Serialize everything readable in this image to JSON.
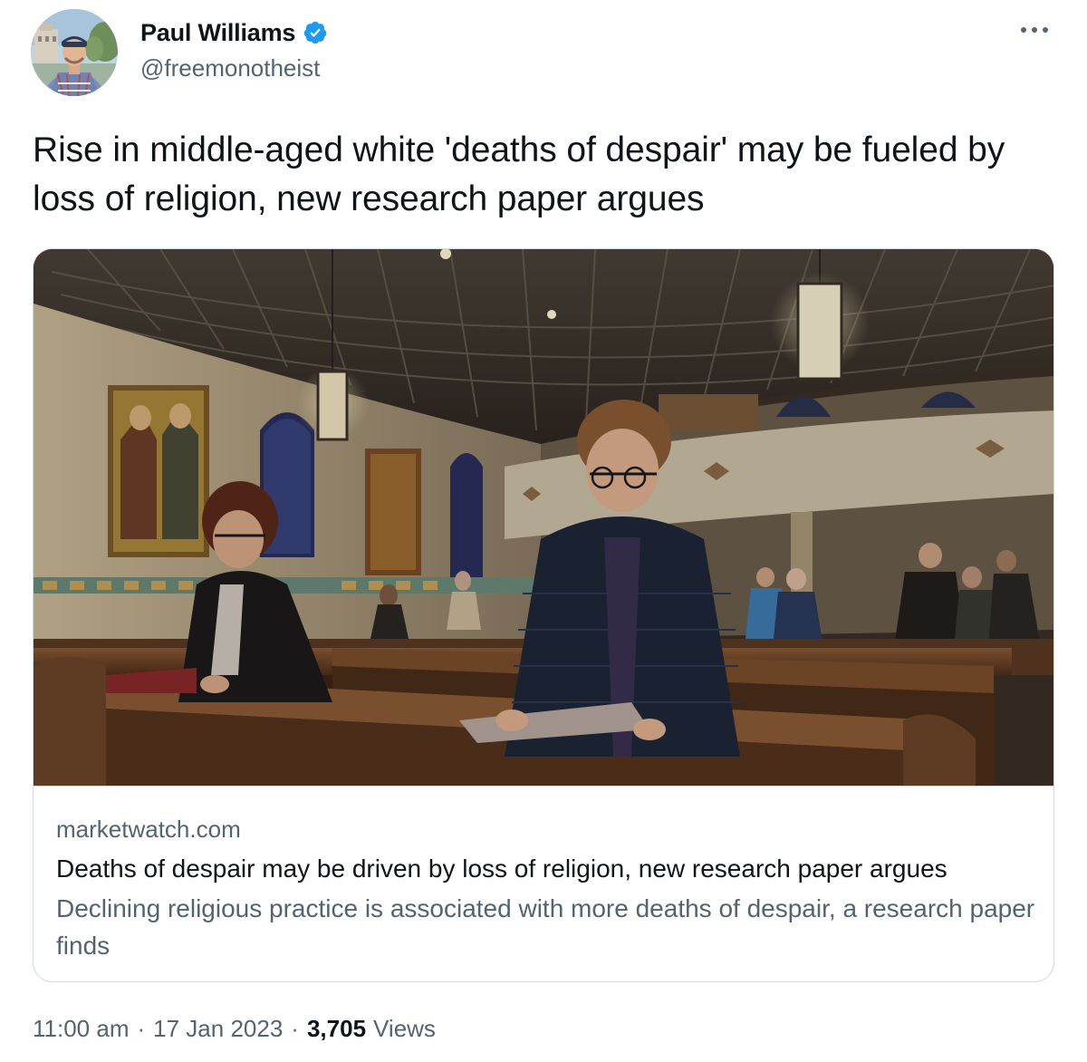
{
  "author": {
    "display_name": "Paul Williams",
    "handle": "@freemonotheist",
    "verified": true,
    "avatar_icon": "profile-photo"
  },
  "tweet": {
    "text": "Rise in middle-aged white 'deaths of despair' may be fueled by loss of religion, new research paper argues"
  },
  "card": {
    "image_icon": "church-interior-photo",
    "domain": "marketwatch.com",
    "title": "Deaths of despair may be driven by loss of religion, new research paper argues",
    "description": "Declining religious practice is associated with more deaths of despair, a research paper finds"
  },
  "meta": {
    "time": "11:00 am",
    "separator": "·",
    "date": "17 Jan 2023",
    "views_count": "3,705",
    "views_label": "Views"
  },
  "colors": {
    "text_primary": "#0f1419",
    "text_secondary": "#536471",
    "verified_blue": "#1d9bf0",
    "border": "#cfd9de"
  },
  "icons": {
    "verified": "verified-badge-icon",
    "more": "more-options-icon"
  }
}
